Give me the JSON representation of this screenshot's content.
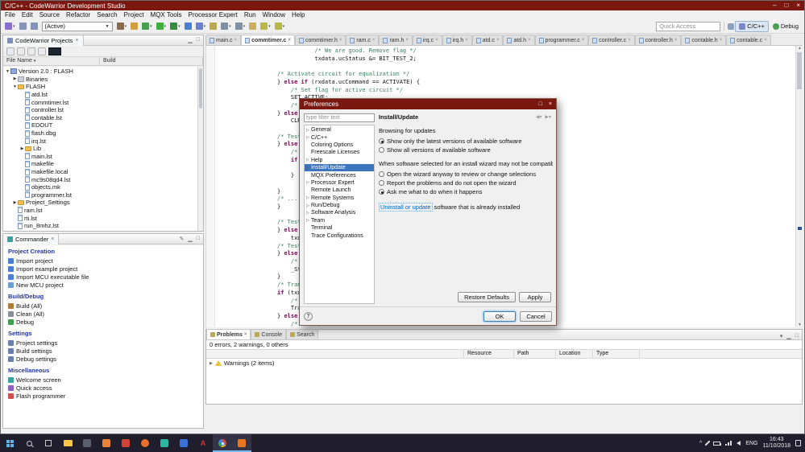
{
  "window": {
    "title": "C/C++ - CodeWarrior Development Studio",
    "minimize": "–",
    "maximize": "□",
    "close": "×"
  },
  "menubar": [
    "File",
    "Edit",
    "Source",
    "Refactor",
    "Search",
    "Project",
    "MQX Tools",
    "Processor Expert",
    "Run",
    "Window",
    "Help"
  ],
  "toolbar": {
    "icons_left": [
      {
        "name": "new-wizard-icon",
        "color": "#8a6fd0",
        "caret": true
      },
      {
        "name": "save-icon",
        "color": "#8593b5"
      },
      {
        "name": "save-all-icon",
        "color": "#8593b5"
      }
    ],
    "active_config": "(Active)",
    "icons_mid": [
      {
        "name": "build-icon",
        "color": "#8a6a4a",
        "caret": true
      },
      {
        "name": "flash-programmer-icon",
        "color": "#d0a040"
      },
      {
        "name": "debug-icon",
        "color": "#4a9e50",
        "ca ret": false,
        "caret": true
      },
      {
        "name": "run-icon",
        "color": "#3fae3f",
        "caret": true
      },
      {
        "name": "external-tools-icon",
        "color": "#2f8e3f",
        "caret": true
      },
      {
        "name": "new-connection-icon",
        "color": "#4a7fd4"
      },
      {
        "name": "search-toolbar-icon",
        "color": "#6a7fd0",
        "caret": true
      },
      {
        "name": "open-element-icon",
        "color": "#b8a858"
      },
      {
        "name": "next-annotation-icon",
        "color": "#8090a0",
        "caret": true
      },
      {
        "name": "previous-annotation-icon",
        "color": "#8090a0",
        "caret": true
      },
      {
        "name": "last-edit-location-icon",
        "color": "#c8b060"
      },
      {
        "name": "back-icon",
        "color": "#b8b848",
        "caret": true
      },
      {
        "name": "forward-icon",
        "color": "#b8b848",
        "caret": true
      }
    ],
    "quick_access_placeholder": "Quick Access",
    "perspectives": [
      {
        "label": "C/C++",
        "active": true
      },
      {
        "label": "Debug",
        "active": false
      }
    ]
  },
  "projects_panel": {
    "title": "CodeWarrior Projects",
    "toolbar_icons": [
      {
        "name": "collapse-all-icon"
      },
      {
        "name": "expand-all-icon"
      },
      {
        "name": "link-with-editor-icon"
      },
      {
        "name": "view-menu-icon"
      },
      {
        "name": "focused-cell-indicator",
        "dark": true
      }
    ],
    "columns": {
      "file_name": "File Name",
      "build": "Build"
    },
    "tree": [
      {
        "depth": 0,
        "icon": "project",
        "label": "Version 2.0 : FLASH",
        "state": "expanded"
      },
      {
        "depth": 1,
        "icon": "binaries",
        "label": "Binaries",
        "state": "collapsed"
      },
      {
        "depth": 1,
        "icon": "folder",
        "label": "FLASH",
        "state": "expanded"
      },
      {
        "depth": 2,
        "icon": "file",
        "label": "atd.lst"
      },
      {
        "depth": 2,
        "icon": "file",
        "label": "commtimer.lst"
      },
      {
        "depth": 2,
        "icon": "file",
        "label": "controller.lst"
      },
      {
        "depth": 2,
        "icon": "file",
        "label": "contable.lst"
      },
      {
        "depth": 2,
        "icon": "file",
        "label": "EDOUT"
      },
      {
        "depth": 2,
        "icon": "file",
        "label": "flash.dbg"
      },
      {
        "depth": 2,
        "icon": "file",
        "label": "irq.lst"
      },
      {
        "depth": 2,
        "icon": "folder",
        "label": "Lib",
        "state": "collapsed"
      },
      {
        "depth": 2,
        "icon": "file",
        "label": "main.lst"
      },
      {
        "depth": 2,
        "icon": "file",
        "label": "makefile"
      },
      {
        "depth": 2,
        "icon": "file",
        "label": "makefile.local"
      },
      {
        "depth": 2,
        "icon": "file",
        "label": "mc9s08qd4.lst"
      },
      {
        "depth": 2,
        "icon": "file",
        "label": "objects.mk"
      },
      {
        "depth": 2,
        "icon": "file",
        "label": "programmer.lst"
      },
      {
        "depth": 1,
        "icon": "folder",
        "label": "Project_Settings",
        "state": "collapsed"
      },
      {
        "depth": 1,
        "icon": "file",
        "label": "ram.lst"
      },
      {
        "depth": 1,
        "icon": "file",
        "label": "rti.lst"
      },
      {
        "depth": 1,
        "icon": "file",
        "label": "run_8mhz.lst"
      }
    ]
  },
  "commander_panel": {
    "title": "Commander",
    "sections": [
      {
        "title": "Project Creation",
        "items": [
          {
            "icon": "import-project-icon",
            "color": "#4a7fd4",
            "label": "Import project"
          },
          {
            "icon": "import-example-project-icon",
            "color": "#4a7fd4",
            "label": "Import example project"
          },
          {
            "icon": "import-mcu-executable-icon",
            "color": "#4a7fd4",
            "label": "Import MCU executable file"
          },
          {
            "icon": "new-mcu-project-icon",
            "color": "#6a9fd4",
            "label": "New MCU project"
          }
        ]
      },
      {
        "title": "Build/Debug",
        "items": [
          {
            "icon": "build-all-icon",
            "color": "#b07a3e",
            "label": "Build (All)"
          },
          {
            "icon": "clean-all-icon",
            "color": "#8a8f98",
            "label": "Clean (All)"
          },
          {
            "icon": "debug-commander-icon",
            "color": "#3f9e4d",
            "label": "Debug"
          }
        ]
      },
      {
        "title": "Settings",
        "items": [
          {
            "icon": "project-settings-icon",
            "color": "#6a7fb0",
            "label": "Project settings"
          },
          {
            "icon": "build-settings-icon",
            "color": "#6a7fb0",
            "label": "Build settings"
          },
          {
            "icon": "debug-settings-icon",
            "color": "#6a7fb0",
            "label": "Debug settings"
          }
        ]
      },
      {
        "title": "Miscellaneous",
        "items": [
          {
            "icon": "welcome-screen-icon",
            "color": "#3aa0a0",
            "label": "Welcome screen"
          },
          {
            "icon": "quick-access-icon",
            "color": "#8a5fc0",
            "label": "Quick access"
          },
          {
            "icon": "flash-programmer-cmd-icon",
            "color": "#d04f4f",
            "label": "Flash programmer"
          }
        ]
      }
    ]
  },
  "editor": {
    "tabs": [
      {
        "label": "main.c"
      },
      {
        "label": "commtimer.c",
        "active": true
      },
      {
        "label": "commtimer.h"
      },
      {
        "label": "ram.c"
      },
      {
        "label": "ram.h"
      },
      {
        "label": "irq.c"
      },
      {
        "label": "irq.h"
      },
      {
        "label": "atd.c"
      },
      {
        "label": "atd.h"
      },
      {
        "label": "programmer.c"
      },
      {
        "label": "controller.c"
      },
      {
        "label": "controller.h"
      },
      {
        "label": "contable.h"
      },
      {
        "label": "contable.c"
      }
    ],
    "code_lines": [
      "           /* We are good. Remove flag */",
      "           txdata.ucStatus &= BIT_TEST_2;",
      "",
      "/* Activate circuit for equalization */",
      "} else if (rxdata.ucCommand == ACTIVATE) {",
      "    /* Set flag for active circuit */",
      "    SET_ACTIVE;",
      "    /* Deactivate circuit for equalisation, Slow mode */",
      "} else {",
      "    CLR_ACTIVE;",
      "",
      "/* Test for active circuit */",
      "} else if (rxdata.ucCommand == TEST) {",
      "    /* Check current status */",
      "    if (txdata.ucStatus & BIT_ACTIVE) {",
      "",
      "    }",
      "",
      "}",
      "/* ... */",
      "}",
      "",
      "/* Test flag set */",
      "} else if (rxdata.ucCommand == TEST_1) {",
      "    txdata.ucStatus |= BIT_TEST_1;",
      "/* Test flag check */",
      "} else if (rxdata.ucCommand == TEST_2) {",
      "    /* Update status */",
      "    _Status = 0;",
      "}",
      "/* Transmit response */",
      "if (txdata.ucStatus) {",
      "    /* Send data */",
      "    Transmit();",
      "} else {",
      "    /* ... */"
    ]
  },
  "problems_panel": {
    "tabs": [
      {
        "label": "Problems",
        "active": true
      },
      {
        "label": "Console"
      },
      {
        "label": "Search"
      }
    ],
    "summary": "0 errors, 2 warnings, 0 others",
    "columns": [
      "",
      "Resource",
      "Path",
      "Location",
      "Type"
    ],
    "rows": [
      {
        "label": "Warnings (2 items)",
        "icon": "warning-icon"
      }
    ]
  },
  "dialog": {
    "title": "Preferences",
    "filter_placeholder": "type filter text",
    "tree": [
      {
        "label": "General",
        "arrow": true
      },
      {
        "label": "C/C++",
        "arrow": true
      },
      {
        "label": "Coloring Options"
      },
      {
        "label": "Freescale Licenses"
      },
      {
        "label": "Help",
        "arrow": true
      },
      {
        "label": "Install/Update",
        "arrow": true,
        "selected": true
      },
      {
        "label": "MQX Preferences"
      },
      {
        "label": "Processor Expert",
        "arrow": true
      },
      {
        "label": "Remote Launch"
      },
      {
        "label": "Remote Systems",
        "arrow": true
      },
      {
        "label": "Run/Debug",
        "arrow": true
      },
      {
        "label": "Software Analysis",
        "arrow": true
      },
      {
        "label": "Team",
        "arrow": true
      },
      {
        "label": "Terminal"
      },
      {
        "label": "Trace Configurations"
      }
    ],
    "page_title": "Install/Update",
    "groups": [
      {
        "label": "Browsing for updates",
        "options": [
          {
            "label": "Show only the latest versions of available software",
            "selected": true
          },
          {
            "label": "Show all versions of available software",
            "selected": false
          }
        ]
      },
      {
        "label": "When software selected for an install wizard may not be compatible",
        "options": [
          {
            "label": "Open the wizard anyway to review or change selections",
            "selected": false
          },
          {
            "label": "Report the problems and do not open the wizard",
            "selected": false
          },
          {
            "label": "Ask me what to do when it happens",
            "selected": true
          }
        ]
      }
    ],
    "link_text": "Uninstall or update",
    "link_suffix": " software that is already installed",
    "buttons": {
      "restore": "Restore Defaults",
      "apply": "Apply",
      "ok": "OK",
      "cancel": "Cancel",
      "help": "?"
    }
  },
  "taskbar": {
    "icons": [
      {
        "name": "start-button",
        "shape": "windows"
      },
      {
        "name": "taskbar-search-icon",
        "shape": "search"
      },
      {
        "name": "task-view-icon",
        "shape": "taskview"
      },
      {
        "name": "file-explorer-icon",
        "shape": "folder"
      },
      {
        "name": "app-icon-1",
        "shape": "square",
        "color": "#5a6070"
      },
      {
        "name": "app-icon-2",
        "shape": "square",
        "color": "#e8833a"
      },
      {
        "name": "app-icon-3",
        "shape": "square",
        "color": "#cf4436"
      },
      {
        "name": "firefox-icon",
        "shape": "circle",
        "color": "#e8702a"
      },
      {
        "name": "app-icon-4",
        "shape": "square",
        "color": "#2bb3a3"
      },
      {
        "name": "app-icon-5",
        "shape": "square",
        "color": "#3d6fd8"
      },
      {
        "name": "app-icon-a",
        "shape": "letter",
        "letter": "A",
        "color": "#d13438"
      },
      {
        "name": "chrome-icon",
        "shape": "chrome",
        "active": true
      },
      {
        "name": "codewarrior-icon",
        "shape": "square",
        "color": "#e87722",
        "active": true
      }
    ],
    "tray": {
      "language": "ENG",
      "time": "16:43",
      "date": "11/10/2018"
    }
  },
  "colors": {
    "titlebar": "#7a170e",
    "tree_selection": "#3b74bf",
    "comment_green": "#3f7f5f",
    "keyword_purple": "#7f0055",
    "warning_yellow": "#f0c030",
    "link_blue": "#0063c6"
  }
}
